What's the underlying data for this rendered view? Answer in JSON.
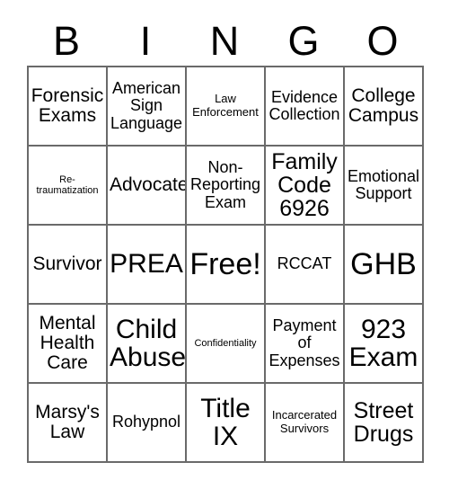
{
  "card": {
    "title_letters": [
      "B",
      "I",
      "N",
      "G",
      "O"
    ],
    "columns": 5,
    "rows": 5,
    "free_space_label": "Free!",
    "free_space_position": {
      "row": 3,
      "column": 3
    },
    "colors": {
      "background": "#ffffff",
      "text": "#000000",
      "grid_line": "#6a6a6a"
    },
    "cells": [
      [
        {
          "text": "Forensic Exams",
          "size": "l"
        },
        {
          "text": "American Sign Language",
          "size": "m"
        },
        {
          "text": "Law Enforcement",
          "size": "xs"
        },
        {
          "text": "Evidence Collection",
          "size": "m"
        },
        {
          "text": "College Campus",
          "size": "l"
        }
      ],
      [
        {
          "text": "Re-\ntraumatization",
          "size": "xxs"
        },
        {
          "text": "Advocate",
          "size": "l"
        },
        {
          "text": "Non-Reporting Exam",
          "size": "m"
        },
        {
          "text": "Family Code 6926",
          "size": "xl"
        },
        {
          "text": "Emotional Support",
          "size": "m"
        }
      ],
      [
        {
          "text": "Survivor",
          "size": "l"
        },
        {
          "text": "PREA",
          "size": "xxl"
        },
        {
          "text": "Free!",
          "size": "3xl"
        },
        {
          "text": "RCCAT",
          "size": "m"
        },
        {
          "text": "GHB",
          "size": "3xl"
        }
      ],
      [
        {
          "text": "Mental Health Care",
          "size": "l"
        },
        {
          "text": "Child Abuse",
          "size": "xxl"
        },
        {
          "text": "Confidentiality",
          "size": "xxs"
        },
        {
          "text": "Payment of Expenses",
          "size": "m"
        },
        {
          "text": "923 Exam",
          "size": "xxl"
        }
      ],
      [
        {
          "text": "Marsy's Law",
          "size": "l"
        },
        {
          "text": "Rohypnol",
          "size": "m"
        },
        {
          "text": "Title IX",
          "size": "xxl"
        },
        {
          "text": "Incarcerated Survivors",
          "size": "xs"
        },
        {
          "text": "Street Drugs",
          "size": "xl"
        }
      ]
    ]
  }
}
